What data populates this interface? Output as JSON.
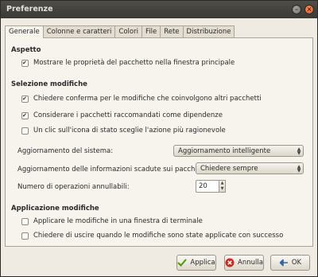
{
  "window": {
    "title": "Preferenze"
  },
  "tabs": [
    "Generale",
    "Colonne e caratteri",
    "Colori",
    "File",
    "Rete",
    "Distribuzione"
  ],
  "aspetto": {
    "heading": "Aspetto",
    "items": [
      {
        "label": "Mostrare le proprietà del pacchetto nella finestra principale",
        "checked": true
      }
    ]
  },
  "selezione": {
    "heading": "Selezione modifiche",
    "items": [
      {
        "label": "Chiedere conferma per le modifiche che coinvolgono altri pacchetti",
        "checked": true
      },
      {
        "label": "Considerare i pacchetti raccomandati come dipendenze",
        "checked": true
      },
      {
        "label": "Un clic sull'icona di stato sceglie l'azione più ragionevole",
        "checked": false
      }
    ]
  },
  "settings": {
    "aggiornamento_label": "Aggiornamento del sistema:",
    "aggiornamento_value": "Aggiornamento intelligente",
    "info_label": "Aggiornamento delle informazioni scadute sui pacchetti:",
    "info_value": "Chiedere sempre",
    "undo_label": "Numero di operazioni annullabili:",
    "undo_value": "20"
  },
  "applicazione": {
    "heading": "Applicazione modifiche",
    "items": [
      {
        "label": "Applicare le modifiche in una finestra di terminale",
        "checked": false
      },
      {
        "label": "Chiedere di uscire quando le modifiche sono state applicate con successo",
        "checked": false
      }
    ]
  },
  "buttons": {
    "apply": "Applica",
    "cancel": "Annulla",
    "ok": "OK"
  }
}
